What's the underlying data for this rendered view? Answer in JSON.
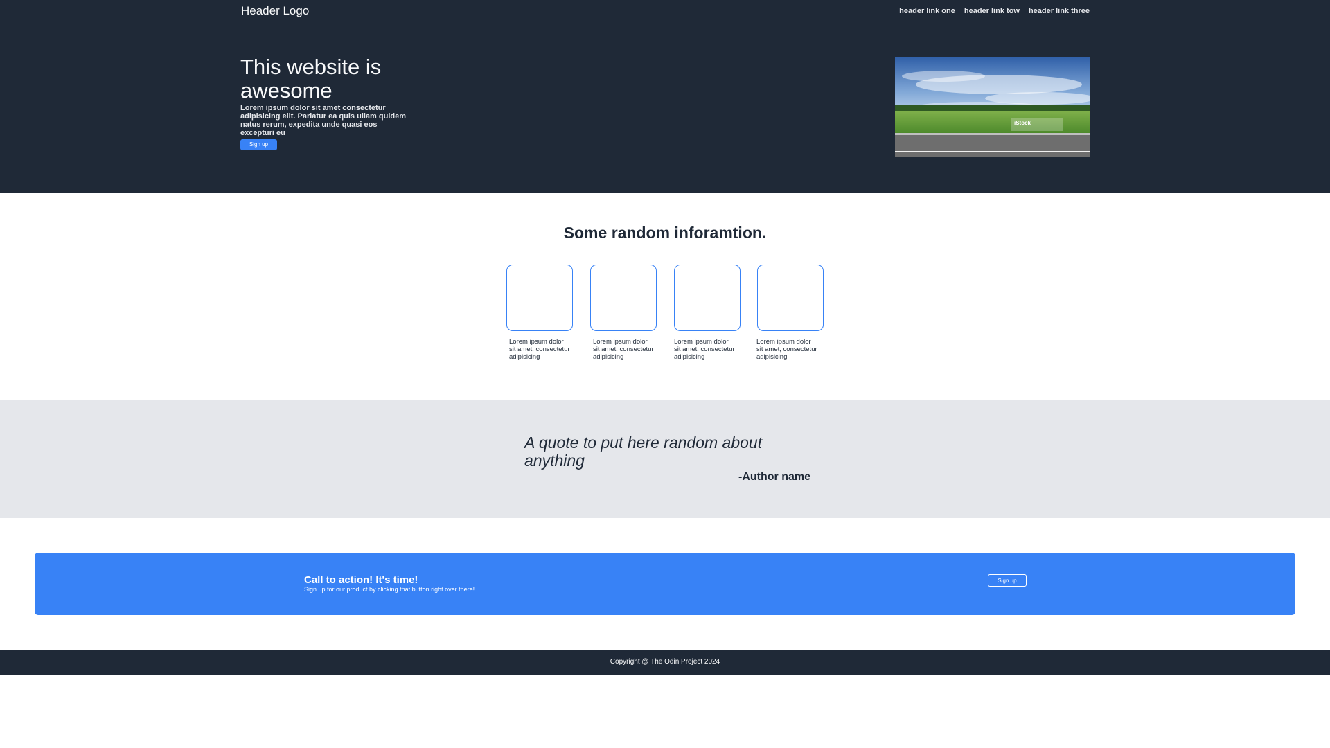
{
  "header": {
    "logo": "Header Logo",
    "links": [
      "header link one",
      "header link tow",
      "header link three"
    ]
  },
  "hero": {
    "title": "This website is awesome",
    "subtitle": "Lorem ipsum dolor sit amet consectetur adipisicing elit. Pariatur ea quis ullam quidem natus rerum, expedita unde quasi eos excepturi eu",
    "button_label": "Sign up",
    "image_caption": "iStock"
  },
  "info": {
    "title": "Some random inforamtion.",
    "cards": [
      "Lorem ipsum dolor sit amet, consectetur adipisicing",
      "Lorem ipsum dolor sit amet, consectetur adipisicing",
      "Lorem ipsum dolor sit amet, consectetur adipisicing",
      "Lorem ipsum dolor sit amet, consectetur adipisicing"
    ]
  },
  "quote": {
    "text": "A quote to put here random about anything",
    "author": "-Author name"
  },
  "cta": {
    "title": "Call to action! It's time!",
    "subtitle": "Sign up for our product by clicking that button right over there!",
    "button_label": "Sign up"
  },
  "footer": {
    "text": "Copyright @ The Odin Project 2024"
  },
  "colors": {
    "dark": "#1f2937",
    "accent": "#3882f6",
    "light_gray": "#e5e7eb"
  }
}
